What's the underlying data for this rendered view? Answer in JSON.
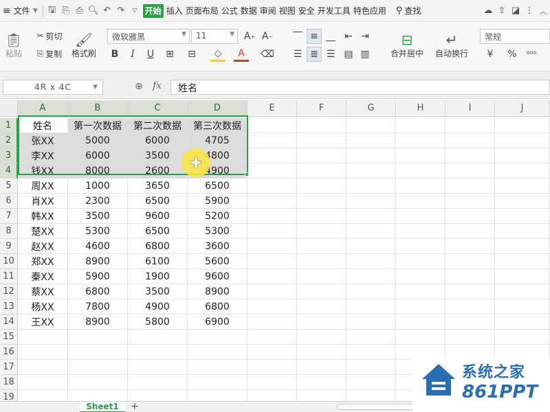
{
  "menubar": {
    "file": "文件",
    "tabs": [
      "开始",
      "插入",
      "页面布局",
      "公式",
      "数据",
      "审阅",
      "视图",
      "安全",
      "开发工具",
      "特色应用"
    ],
    "active_tab": "开始",
    "search": "查找"
  },
  "ribbon": {
    "paste": "粘贴",
    "cut": "剪切",
    "copy": "复制",
    "format_painter": "格式刷",
    "font_name": "微软雅黑",
    "font_size": "11",
    "merge_center": "合并居中",
    "wrap_text": "自动换行",
    "number_format": "常规",
    "bold": "B",
    "italic": "I",
    "underline": "U",
    "font_color": "A",
    "currency": "¥",
    "percent": "%"
  },
  "formula_bar": {
    "name_box": "4R x 4C",
    "fx": "fx",
    "value": "姓名"
  },
  "grid": {
    "columns": [
      "A",
      "B",
      "C",
      "D",
      "E",
      "F",
      "G",
      "H",
      "I",
      "J"
    ],
    "rows": [
      "1",
      "2",
      "3",
      "4",
      "5",
      "6",
      "7",
      "8",
      "9",
      "10",
      "11",
      "12",
      "13",
      "14",
      "15",
      "16",
      "17",
      "18",
      "19"
    ],
    "data": [
      [
        "姓名",
        "第一次数据",
        "第二次数据",
        "第三次数据"
      ],
      [
        "张XX",
        "5000",
        "6000",
        "4705"
      ],
      [
        "李XX",
        "6000",
        "3500",
        "4800"
      ],
      [
        "钱XX",
        "8000",
        "2600",
        "4900"
      ],
      [
        "周XX",
        "1000",
        "3650",
        "6500"
      ],
      [
        "肖XX",
        "2300",
        "6500",
        "5900"
      ],
      [
        "韩XX",
        "3500",
        "9600",
        "5200"
      ],
      [
        "楚XX",
        "5300",
        "6500",
        "5300"
      ],
      [
        "赵XX",
        "4600",
        "6800",
        "3600"
      ],
      [
        "郑XX",
        "8900",
        "6100",
        "5600"
      ],
      [
        "秦XX",
        "5900",
        "1900",
        "9600"
      ],
      [
        "蔡XX",
        "6800",
        "3500",
        "8900"
      ],
      [
        "杨XX",
        "7800",
        "4900",
        "6800"
      ],
      [
        "王XX",
        "8900",
        "5800",
        "6900"
      ]
    ]
  },
  "sheets": {
    "active": "Sheet1",
    "add": "+"
  },
  "watermark": {
    "title": "系统之家",
    "subtitle": "861PPT"
  },
  "colors": {
    "accent": "#2e9e4a",
    "selection_fill": "#dcdcdc",
    "cursor_halo": "#fae63c"
  }
}
